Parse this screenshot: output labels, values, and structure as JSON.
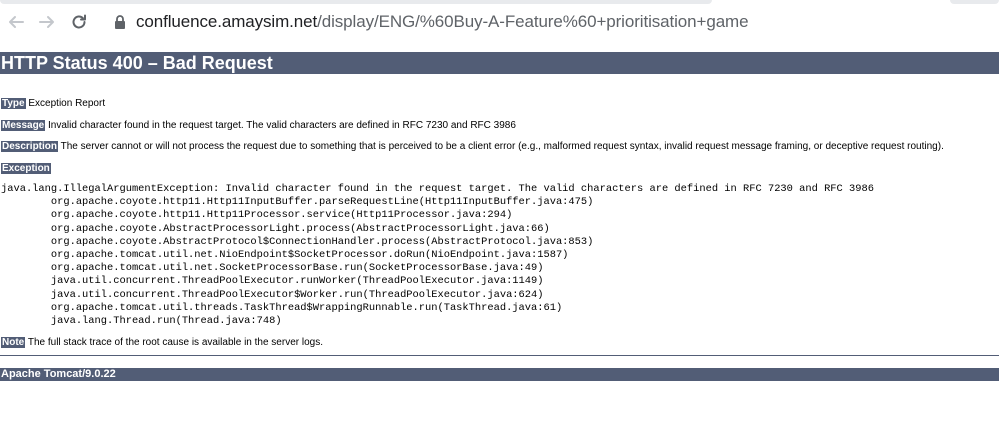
{
  "browser": {
    "url_host": "confluence.amaysim.net",
    "url_path": "/display/ENG/%60Buy-A-Feature%60+prioritisation+game",
    "icons": {
      "back": "arrow-left-icon",
      "forward": "arrow-right-icon",
      "reload": "reload-icon",
      "lock": "lock-icon"
    }
  },
  "page": {
    "title": "HTTP Status 400 – Bad Request",
    "type": {
      "label": "Type",
      "text": "Exception Report"
    },
    "message": {
      "label": "Message",
      "text": "Invalid character found in the request target. The valid characters are defined in RFC 7230 and RFC 3986"
    },
    "description": {
      "label": "Description",
      "text": "The server cannot or will not process the request due to something that is perceived to be a client error (e.g., malformed request syntax, invalid request message framing, or deceptive request routing)."
    },
    "exception_label": "Exception",
    "stack_trace": [
      "java.lang.IllegalArgumentException: Invalid character found in the request target. The valid characters are defined in RFC 7230 and RFC 3986",
      "\torg.apache.coyote.http11.Http11InputBuffer.parseRequestLine(Http11InputBuffer.java:475)",
      "\torg.apache.coyote.http11.Http11Processor.service(Http11Processor.java:294)",
      "\torg.apache.coyote.AbstractProcessorLight.process(AbstractProcessorLight.java:66)",
      "\torg.apache.coyote.AbstractProtocol$ConnectionHandler.process(AbstractProtocol.java:853)",
      "\torg.apache.tomcat.util.net.NioEndpoint$SocketProcessor.doRun(NioEndpoint.java:1587)",
      "\torg.apache.tomcat.util.net.SocketProcessorBase.run(SocketProcessorBase.java:49)",
      "\tjava.util.concurrent.ThreadPoolExecutor.runWorker(ThreadPoolExecutor.java:1149)",
      "\tjava.util.concurrent.ThreadPoolExecutor$Worker.run(ThreadPoolExecutor.java:624)",
      "\torg.apache.tomcat.util.threads.TaskThread$WrappingRunnable.run(TaskThread.java:61)",
      "\tjava.lang.Thread.run(Thread.java:748)"
    ],
    "note": {
      "label": "Note",
      "text": "The full stack trace of the root cause is available in the server logs."
    },
    "footer": "Apache Tomcat/9.0.22"
  },
  "colors": {
    "tomcat_header": "#525d76",
    "text": "#000000",
    "url_path": "#5f6368",
    "url_host": "#202124",
    "toolbar_icon": "#5f6368"
  }
}
